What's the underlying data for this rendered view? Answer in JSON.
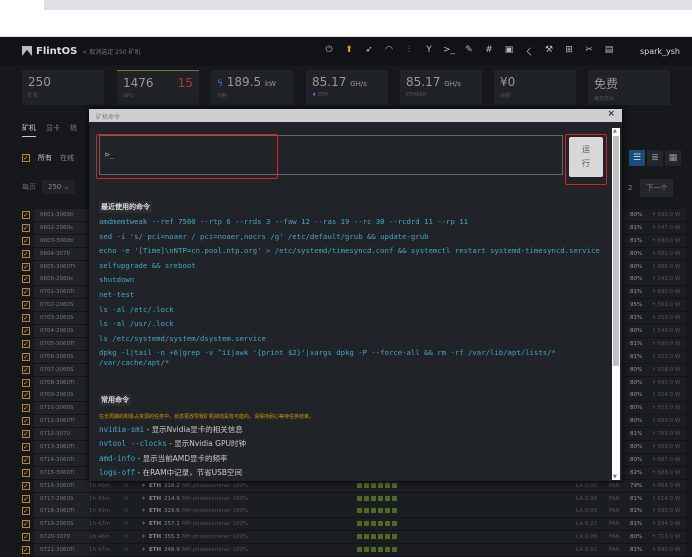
{
  "browser": {
    "tab": "",
    "url": ""
  },
  "header": {
    "brand": "FlintOS",
    "breadcrumb": "< 取消选定  250 矿机",
    "user": "spark_ysh",
    "icons": [
      "power-icon",
      "upgrade-icon",
      "rocket-icon",
      "gauge-icon",
      "tuning-icon",
      "fork-icon",
      "terminal-icon",
      "brush-icon",
      "hash-icon",
      "console-icon",
      "flash-icon",
      "tools-icon",
      "grid-icon",
      "wrench-icon",
      "menu-icon"
    ]
  },
  "stats": [
    {
      "value": "250",
      "unit": "",
      "label": "矿机"
    },
    {
      "value": "1476",
      "extra": "15",
      "unit": "",
      "label": "GPU"
    },
    {
      "value": "189.5",
      "unit": "kW",
      "label": "功耗"
    },
    {
      "value": "85.17",
      "unit": "GH/s",
      "label": "ETH"
    },
    {
      "value": "85.17",
      "unit": "GH/s",
      "label": "ETHASH"
    },
    {
      "value": "¥0",
      "unit": "",
      "label": "余额"
    },
    {
      "value": "免费",
      "unit": "",
      "label": "每日支出"
    }
  ],
  "bg": {
    "tabs": [
      "矿机",
      "显卡",
      "统"
    ],
    "filters": [
      "所有",
      "在线"
    ],
    "per_page_label": "每页",
    "per_page": "250",
    "page": "2",
    "next": "下一个"
  },
  "rows": [
    {
      "name": "0601-3060ti",
      "pct": "80%",
      "power": "690.0 W"
    },
    {
      "name": "0602-2060s",
      "pct": "81%",
      "power": "547.0 W"
    },
    {
      "name": "0603-3060ti",
      "pct": "81%",
      "power": "690.0 W"
    },
    {
      "name": "0604-3070",
      "pct": "80%",
      "power": "601.0 W"
    },
    {
      "name": "0605-3060TI",
      "pct": "80%",
      "power": "686.0 W"
    },
    {
      "name": "0606-2060s",
      "pct": "80%",
      "power": "543.0 W"
    },
    {
      "name": "0701-3060Ti",
      "pct": "81%",
      "power": "690.0 W"
    },
    {
      "name": "0702-2060S",
      "pct": "95%",
      "power": "562.0 W"
    },
    {
      "name": "0703-2060S",
      "pct": "81%",
      "power": "559.0 W"
    },
    {
      "name": "0704-2060S",
      "pct": "80%",
      "power": "549.0 W"
    },
    {
      "name": "0705-3060Ti",
      "pct": "81%",
      "power": "690.0 W"
    },
    {
      "name": "0706-2060S",
      "pct": "81%",
      "power": "553.0 W"
    },
    {
      "name": "0707-2060S",
      "pct": "80%",
      "power": "558.0 W"
    },
    {
      "name": "0708-3060Ti",
      "pct": "80%",
      "power": "690.0 W"
    },
    {
      "name": "0709-2060S",
      "pct": "80%",
      "power": "554.0 W"
    },
    {
      "name": "0710-2060S",
      "pct": "80%",
      "power": "553.0 W"
    },
    {
      "name": "0711-3060Ti",
      "pct": "80%",
      "power": "689.0 W"
    },
    {
      "name": "0712-3070",
      "pct": "81%",
      "power": "709.0 W"
    },
    {
      "name": "0713-3060Ti",
      "pct": "80%",
      "power": "689.0 W"
    },
    {
      "name": "0714-3060Ti",
      "pct": "80%",
      "power": "687.0 W"
    },
    {
      "name": "0715-3060Ti",
      "pct": "82%",
      "power": "688.0 W"
    },
    {
      "name": "0716-3060Ti",
      "pct": "79%",
      "power": "664.0 W",
      "uptime": "1h 46m",
      "n": "N",
      "coin": "ETH",
      "hash": "318.2",
      "algo": "MH phoenixminer 100%",
      "la": "LA 0.00",
      "fan": "FAN"
    },
    {
      "name": "0717-2060S",
      "pct": "81%",
      "power": "614.0 W",
      "uptime": "1h 49m",
      "n": "N",
      "coin": "ETH",
      "hash": "214.9",
      "algo": "MH phoenixminer 100%",
      "la": "LA 0.36",
      "fan": "FAN"
    },
    {
      "name": "0718-3060Ti",
      "pct": "81%",
      "power": "690.0 W",
      "uptime": "1h 49m",
      "n": "N",
      "coin": "ETH",
      "hash": "329.6",
      "algo": "MH phoenixminer 100%",
      "la": "LA 0.08",
      "fan": "FAN"
    },
    {
      "name": "0719-2060S",
      "pct": "81%",
      "power": "594.0 W",
      "uptime": "1h 47m",
      "n": "N",
      "coin": "ETH",
      "hash": "257.1",
      "algo": "MH phoenixminer 100%",
      "la": "LA 0.22",
      "fan": "FAN"
    },
    {
      "name": "0720-3070",
      "pct": "80%",
      "power": "713.0 W",
      "uptime": "1h 46m",
      "n": "N",
      "coin": "ETH",
      "hash": "355.3",
      "algo": "MH phoenixminer 100%",
      "la": "LA 0.06",
      "fan": "FAN"
    },
    {
      "name": "0721-3060Ti",
      "pct": "81%",
      "power": "690.0 W",
      "uptime": "1h 47m",
      "n": "N",
      "coin": "ETH",
      "hash": "348.9",
      "algo": "MH phoenixminer 100%",
      "la": "LA 0.52",
      "fan": "FAN"
    }
  ],
  "modal": {
    "title": "矿机命令",
    "close": "×",
    "input_value": "⊳_",
    "run": "运行",
    "recent_title": "最近使用的命令",
    "recent": [
      "amdmemtweak --ref 7500 --rtp 6 --rrds 3 --faw 12 --ras 19 --rc 30 --rcdrd 11 --rp 11",
      "sed -i 's/ pci=noaer / pci=noaer,nocrs /g' /etc/default/grub && update-grub",
      "echo -e '[Time]\\nNTP=cn.pool.ntp.org' > /etc/systemd/timesyncd.conf && systemctl restart systemd-timesyncd.service",
      "selfupgrade && sreboot",
      "shutdown",
      "net-test",
      "ls -al /etc/.lock",
      "ls -al /usr/.lock",
      "ls /etc/systemd/system/dsystem.service",
      "dpkg -l|tail -n +6|grep -v ^ii|awk '{print $2}'|xargs dpkg -P --force-all && rm -rf /var/lib/apt/lists/* /var/cache/apt/*"
    ],
    "common_title": "常用命令",
    "warning": "在长周期的和极占资源的任务中，状态更改导致矿机掉线是有可能的。请保持耐心等待任务结束。",
    "common": [
      {
        "cmd": "nvidia-smi",
        "desc": " - 显示Nvidia显卡的相关信息"
      },
      {
        "cmd": "nvtool --clocks",
        "desc": " - 显示Nvidia GPU时钟"
      },
      {
        "cmd": "amd-info",
        "desc": " - 显示当前AMD显卡的频率"
      },
      {
        "cmd": "logs-off",
        "desc": " - 在RAM中记录，节省USB空间"
      }
    ]
  },
  "colors": {
    "accent": "#d4a020",
    "command": "#44a6c8",
    "warning": "#d99a00",
    "highlight": "#e02020"
  }
}
